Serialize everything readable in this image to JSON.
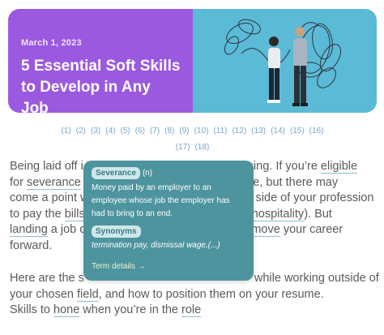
{
  "hero": {
    "date": "March 1, 2023",
    "title": "5 Essential Soft Skills to Develop in Any Job",
    "accent_left": "#9b59e0",
    "accent_right": "#5bbad6"
  },
  "pagination": [
    "(1)",
    "(2)",
    "(3)",
    "(4)",
    "(5)",
    "(6)",
    "(7)",
    "(8)",
    "(9)",
    "(10)",
    "(11)",
    "(12)",
    "(13)",
    "(14)",
    "(15)",
    "(16)",
    "(17)",
    "(18)"
  ],
  "article": {
    "p1": {
      "l1a": "Being laid off i",
      "l1b": "ming. If you’re ",
      "l1link": "eligible",
      "l2a": "for ",
      "l2link": "severance",
      "l2b": "ile, but there may",
      "l3a": "come a point w",
      "l3b": "side of your profession",
      "l4a": "to pay the ",
      "l4link1": "bills",
      "l4link2": "hospitality",
      "l4b": "). But",
      "l5link1": "landing",
      "l5a": " a job o",
      "l5link2": "move",
      "l5b": " your career",
      "l6": "forward."
    },
    "p2": {
      "l1a": "Here are the s",
      "l1b": "while working outside of",
      "l2a": "your chosen ",
      "l2link": "field",
      "l2b": ", and how to position them on your resume.",
      "l3a": "Skills to ",
      "l3link1": "hone",
      "l3b": " when you’re in the ",
      "l3link2": "role"
    }
  },
  "tooltip": {
    "term": "Severance",
    "pos": "(n)",
    "definition": "Money paid by an employer to an employee whose job the employer has had to bring to an end.",
    "synonyms_label": "Synonyms",
    "synonyms": "termination pay, dismissal wage,(...)",
    "details_link": "Term details →",
    "bg_color": "#4e949f"
  }
}
